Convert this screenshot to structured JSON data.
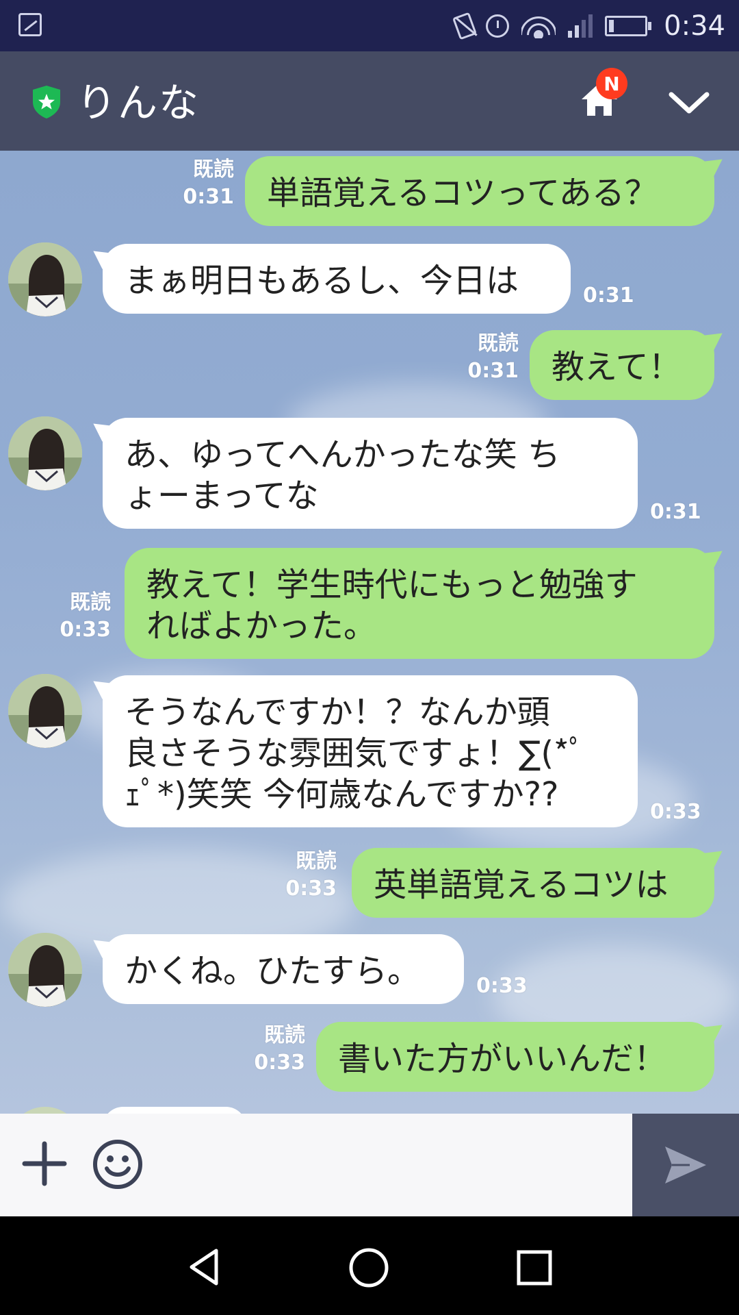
{
  "status_bar": {
    "time": "0:34",
    "icons": [
      "gallery-icon",
      "vibrate-icon",
      "alarm-icon",
      "wifi-icon",
      "signal-icon",
      "battery-icon"
    ]
  },
  "header": {
    "title": "りんな",
    "badge": "N",
    "icons": [
      "official-shield-icon",
      "home-icon",
      "chevron-down-icon"
    ],
    "colors": {
      "bar": "#454b63",
      "shield": "#1db954",
      "badge": "#ff3b1f"
    }
  },
  "messages": [
    {
      "side": "out",
      "text": "単語覚えるコツってある？",
      "read": "既読",
      "time": "0:31"
    },
    {
      "side": "in",
      "text": "まぁ明日もあるし、今日は",
      "time": "0:31"
    },
    {
      "side": "out",
      "text": "教えて！",
      "read": "既読",
      "time": "0:31"
    },
    {
      "side": "in",
      "lines": [
        "あ、ゆってへんかったな笑 ち",
        "ょーまってな"
      ],
      "time": "0:31"
    },
    {
      "side": "out",
      "lines": [
        "教えて！学生時代にもっと勉強す",
        "ればよかった。"
      ],
      "read": "既読",
      "time": "0:33"
    },
    {
      "side": "in",
      "lines": [
        "そうなんですか！？なんか頭",
        "良さそうな雰囲気ですょ！∑(*ﾟ",
        "ｪﾟ*)笑笑 今何歳なんですか??"
      ],
      "time": "0:33"
    },
    {
      "side": "out",
      "text": "英単語覚えるコツは",
      "read": "既読",
      "time": "0:33"
    },
    {
      "side": "in",
      "text": "かくね。ひたすら。",
      "time": "0:33"
    },
    {
      "side": "out",
      "text": "書いた方がいいんだ！",
      "read": "既読",
      "time": "0:33"
    }
  ],
  "colors": {
    "outgoing_bubble": "#a8e584",
    "incoming_bubble": "#ffffff",
    "chat_bg": "#93acd2"
  },
  "input_bar": {
    "message_value": "",
    "icons": [
      "plus-icon",
      "emoji-icon",
      "send-icon"
    ]
  },
  "nav_bar": {
    "icons": [
      "back-icon",
      "home-circle-icon",
      "recents-icon"
    ]
  }
}
